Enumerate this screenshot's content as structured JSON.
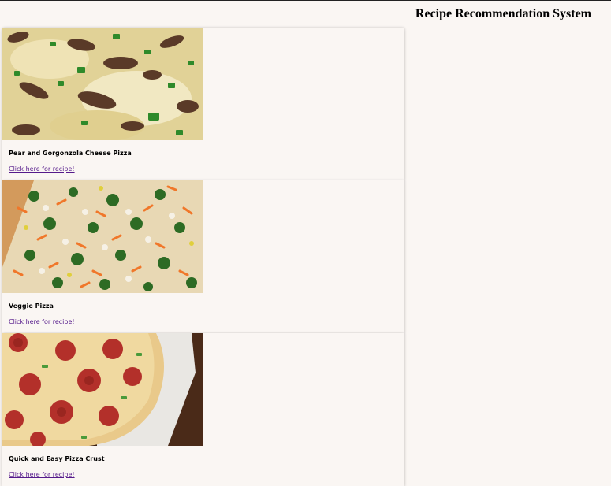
{
  "header": {
    "title": "Recipe Recommendation System"
  },
  "cards": [
    {
      "title": "Pear and Gorgonzola Cheese Pizza",
      "link_label": "Click here for recipe!",
      "image_icon": "pear-gorgonzola-pizza-photo"
    },
    {
      "title": "Veggie Pizza",
      "link_label": "Click here for recipe!",
      "image_icon": "veggie-pizza-photo"
    },
    {
      "title": "Quick and Easy Pizza Crust",
      "link_label": "Click here for recipe!",
      "image_icon": "pepperoni-pizza-photo"
    }
  ],
  "colors": {
    "background": "#faf6f3",
    "link": "#551a8b"
  }
}
